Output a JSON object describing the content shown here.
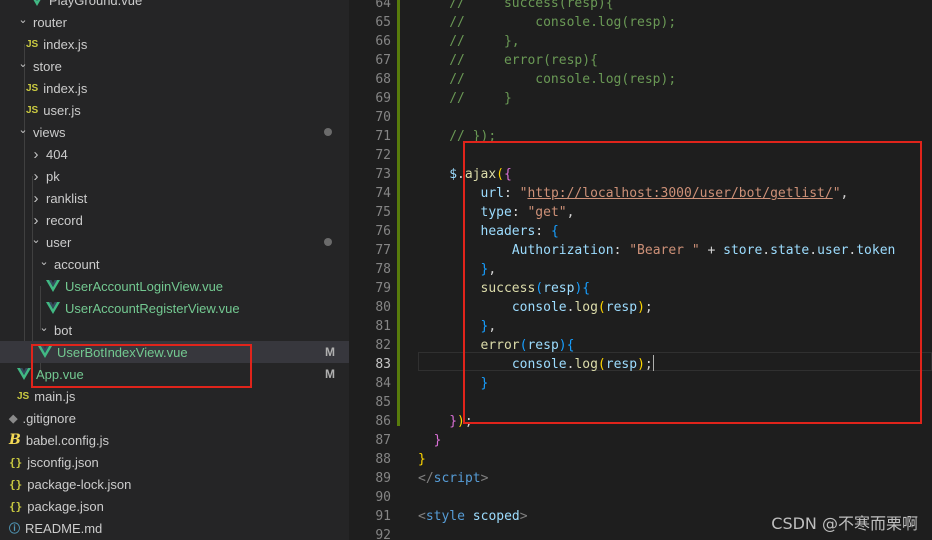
{
  "colors": {
    "editor_bg": "#1e1e1e",
    "sidebar_bg": "#252526",
    "selection": "#37373d",
    "highlight": "#e0241b",
    "git_added": "#587c0c",
    "vue_icon": "#41b883",
    "modified": "#73c991"
  },
  "explorer": {
    "items": [
      {
        "label": "PlayGround.vue",
        "icon": "vue-icon"
      },
      {
        "label": "router",
        "icon": "chevron-down-icon"
      },
      {
        "label": "index.js",
        "icon": "js-icon",
        "icon_text": "JS"
      },
      {
        "label": "store",
        "icon": "chevron-down-icon"
      },
      {
        "label": "index.js",
        "icon": "js-icon",
        "icon_text": "JS"
      },
      {
        "label": "user.js",
        "icon": "js-icon",
        "icon_text": "JS"
      },
      {
        "label": "views",
        "icon": "chevron-down-icon"
      },
      {
        "label": "404",
        "icon": "chevron-right-icon"
      },
      {
        "label": "pk",
        "icon": "chevron-right-icon"
      },
      {
        "label": "ranklist",
        "icon": "chevron-right-icon"
      },
      {
        "label": "record",
        "icon": "chevron-right-icon"
      },
      {
        "label": "user",
        "icon": "chevron-down-icon"
      },
      {
        "label": "account",
        "icon": "chevron-down-icon"
      },
      {
        "label": "UserAccountLoginView.vue",
        "icon": "vue-icon"
      },
      {
        "label": "UserAccountRegisterView.vue",
        "icon": "vue-icon"
      },
      {
        "label": "bot",
        "icon": "chevron-down-icon"
      },
      {
        "label": "UserBotIndexView.vue",
        "icon": "vue-icon",
        "badge": "M"
      },
      {
        "label": "App.vue",
        "icon": "vue-icon",
        "badge": "M"
      },
      {
        "label": "main.js",
        "icon": "js-icon",
        "icon_text": "JS"
      },
      {
        "label": ".gitignore",
        "icon": "git-icon",
        "icon_text": "◆"
      },
      {
        "label": "babel.config.js",
        "icon": "babel-icon",
        "icon_text": "B"
      },
      {
        "label": "jsconfig.json",
        "icon": "json-icon",
        "icon_text": "{}"
      },
      {
        "label": "package-lock.json",
        "icon": "json-icon",
        "icon_text": "{}"
      },
      {
        "label": "package.json",
        "icon": "json-icon",
        "icon_text": "{}"
      },
      {
        "label": "README.md",
        "icon": "info-icon",
        "icon_text": "ⓘ"
      }
    ]
  },
  "editor": {
    "active_line": "83",
    "lines": [
      {
        "n": "64",
        "tokens": [
          {
            "c": "com",
            "t": "//     success(resp){"
          }
        ]
      },
      {
        "n": "65",
        "tokens": [
          {
            "c": "com",
            "t": "//         console.log(resp);"
          }
        ]
      },
      {
        "n": "66",
        "tokens": [
          {
            "c": "com",
            "t": "//     },"
          }
        ]
      },
      {
        "n": "67",
        "tokens": [
          {
            "c": "com",
            "t": "//     error(resp){"
          }
        ]
      },
      {
        "n": "68",
        "tokens": [
          {
            "c": "com",
            "t": "//         console.log(resp);"
          }
        ]
      },
      {
        "n": "69",
        "tokens": [
          {
            "c": "com",
            "t": "//     }"
          }
        ]
      },
      {
        "n": "70",
        "tokens": []
      },
      {
        "n": "71",
        "tokens": [
          {
            "c": "com",
            "t": "// });"
          }
        ]
      },
      {
        "n": "72",
        "tokens": []
      },
      {
        "n": "73",
        "tokens": [
          {
            "c": "var",
            "t": "$"
          },
          {
            "c": "plain",
            "t": "."
          },
          {
            "c": "fn",
            "t": "ajax"
          },
          {
            "c": "br1",
            "t": "("
          },
          {
            "c": "br2",
            "t": "{"
          }
        ]
      },
      {
        "n": "74",
        "tokens": [
          {
            "c": "plain",
            "t": "    "
          },
          {
            "c": "var",
            "t": "url"
          },
          {
            "c": "plain",
            "t": ": "
          },
          {
            "c": "str",
            "t": "\""
          },
          {
            "c": "url",
            "t": "http://localhost:3000/user/bot/getlist/"
          },
          {
            "c": "str",
            "t": "\""
          },
          {
            "c": "plain",
            "t": ","
          }
        ]
      },
      {
        "n": "75",
        "tokens": [
          {
            "c": "plain",
            "t": "    "
          },
          {
            "c": "var",
            "t": "type"
          },
          {
            "c": "plain",
            "t": ": "
          },
          {
            "c": "str",
            "t": "\"get\""
          },
          {
            "c": "plain",
            "t": ","
          }
        ]
      },
      {
        "n": "76",
        "tokens": [
          {
            "c": "plain",
            "t": "    "
          },
          {
            "c": "var",
            "t": "headers"
          },
          {
            "c": "plain",
            "t": ": "
          },
          {
            "c": "br3",
            "t": "{"
          }
        ]
      },
      {
        "n": "77",
        "tokens": [
          {
            "c": "plain",
            "t": "        "
          },
          {
            "c": "var",
            "t": "Authorization"
          },
          {
            "c": "plain",
            "t": ": "
          },
          {
            "c": "str",
            "t": "\"Bearer \""
          },
          {
            "c": "plain",
            "t": " + "
          },
          {
            "c": "var",
            "t": "store"
          },
          {
            "c": "plain",
            "t": "."
          },
          {
            "c": "var",
            "t": "state"
          },
          {
            "c": "plain",
            "t": "."
          },
          {
            "c": "var",
            "t": "user"
          },
          {
            "c": "plain",
            "t": "."
          },
          {
            "c": "var",
            "t": "token"
          }
        ]
      },
      {
        "n": "78",
        "tokens": [
          {
            "c": "plain",
            "t": "    "
          },
          {
            "c": "br3",
            "t": "}"
          },
          {
            "c": "plain",
            "t": ","
          }
        ]
      },
      {
        "n": "79",
        "tokens": [
          {
            "c": "plain",
            "t": "    "
          },
          {
            "c": "fn",
            "t": "success"
          },
          {
            "c": "br3",
            "t": "("
          },
          {
            "c": "var",
            "t": "resp"
          },
          {
            "c": "br3",
            "t": ")"
          },
          {
            "c": "br3",
            "t": "{"
          }
        ]
      },
      {
        "n": "80",
        "tokens": [
          {
            "c": "plain",
            "t": "        "
          },
          {
            "c": "var",
            "t": "console"
          },
          {
            "c": "plain",
            "t": "."
          },
          {
            "c": "fn",
            "t": "log"
          },
          {
            "c": "br1",
            "t": "("
          },
          {
            "c": "var",
            "t": "resp"
          },
          {
            "c": "br1",
            "t": ")"
          },
          {
            "c": "plain",
            "t": ";"
          }
        ]
      },
      {
        "n": "81",
        "tokens": [
          {
            "c": "plain",
            "t": "    "
          },
          {
            "c": "br3",
            "t": "}"
          },
          {
            "c": "plain",
            "t": ","
          }
        ]
      },
      {
        "n": "82",
        "tokens": [
          {
            "c": "plain",
            "t": "    "
          },
          {
            "c": "fn",
            "t": "error"
          },
          {
            "c": "br3",
            "t": "("
          },
          {
            "c": "var",
            "t": "resp"
          },
          {
            "c": "br3",
            "t": ")"
          },
          {
            "c": "br3",
            "t": "{"
          }
        ]
      },
      {
        "n": "83",
        "tokens": [
          {
            "c": "plain",
            "t": "        "
          },
          {
            "c": "var",
            "t": "console"
          },
          {
            "c": "plain",
            "t": "."
          },
          {
            "c": "fn",
            "t": "log"
          },
          {
            "c": "br1",
            "t": "("
          },
          {
            "c": "var",
            "t": "resp"
          },
          {
            "c": "br1",
            "t": ")"
          },
          {
            "c": "plain",
            "t": ";"
          },
          {
            "c": "cursor",
            "t": ""
          }
        ]
      },
      {
        "n": "84",
        "tokens": [
          {
            "c": "plain",
            "t": "    "
          },
          {
            "c": "br3",
            "t": "}"
          }
        ]
      },
      {
        "n": "85",
        "tokens": []
      },
      {
        "n": "86",
        "tokens": [
          {
            "c": "br2",
            "t": "}"
          },
          {
            "c": "br1",
            "t": ")"
          },
          {
            "c": "plain",
            "t": ";"
          }
        ]
      },
      {
        "n": "87",
        "tokens": [
          {
            "c": "br2",
            "t": "}"
          }
        ]
      },
      {
        "n": "88",
        "tokens": [
          {
            "c": "br1",
            "t": "}"
          }
        ]
      },
      {
        "n": "89",
        "tokens": [
          {
            "c": "tag",
            "t": "</"
          },
          {
            "c": "tagn",
            "t": "script"
          },
          {
            "c": "tag",
            "t": ">"
          }
        ]
      },
      {
        "n": "90",
        "tokens": []
      },
      {
        "n": "91",
        "tokens": [
          {
            "c": "tag",
            "t": "<"
          },
          {
            "c": "tagn",
            "t": "style"
          },
          {
            "c": "plain",
            "t": " "
          },
          {
            "c": "attr",
            "t": "scoped"
          },
          {
            "c": "tag",
            "t": ">"
          }
        ]
      },
      {
        "n": "92",
        "tokens": []
      }
    ]
  },
  "watermark": "CSDN @不寒而栗啊"
}
